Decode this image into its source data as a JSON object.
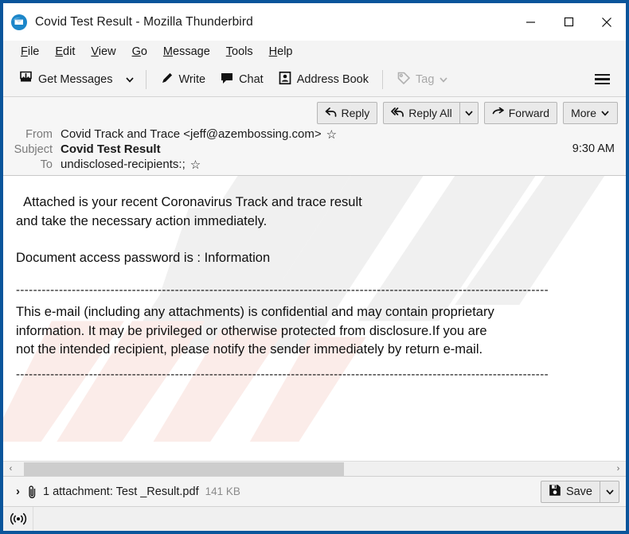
{
  "window": {
    "title": "Covid Test Result - Mozilla Thunderbird",
    "app_icon": "thunderbird-icon",
    "minimize_label": "–",
    "maximize_label": "□",
    "close_label": "✕",
    "frame_color": "#0a559b"
  },
  "menubar": {
    "items": [
      {
        "access": "F",
        "rest": "ile"
      },
      {
        "access": "E",
        "rest": "dit"
      },
      {
        "access": "V",
        "rest": "iew"
      },
      {
        "access": "G",
        "rest": "o"
      },
      {
        "access": "M",
        "rest": "essage"
      },
      {
        "access": "T",
        "rest": "ools"
      },
      {
        "access": "H",
        "rest": "elp"
      }
    ]
  },
  "toolbar": {
    "get_messages_label": "Get Messages",
    "get_messages_icon": "inbox-download-icon",
    "get_messages_caret": "⌄",
    "write_label": "Write",
    "write_icon": "pencil-icon",
    "chat_label": "Chat",
    "chat_icon": "speech-bubble-icon",
    "address_book_label": "Address Book",
    "address_book_icon": "address-book-icon",
    "tag_label": "Tag",
    "tag_icon": "tag-icon",
    "tag_caret": "⌄",
    "tag_disabled": true,
    "app_menu_icon": "hamburger-menu-icon"
  },
  "message_actions": {
    "reply_label": "Reply",
    "reply_icon": "reply-arrow-icon",
    "reply_all_label": "Reply All",
    "reply_all_icon": "reply-all-arrow-icon",
    "reply_all_caret": "⌄",
    "forward_label": "Forward",
    "forward_icon": "forward-arrow-icon",
    "more_label": "More",
    "more_caret": "⌄"
  },
  "message_header": {
    "from_label": "From",
    "from_value": "Covid Track and Trace <jeff@azembossing.com>",
    "from_star_icon": "star-outline-icon",
    "subject_label": "Subject",
    "subject_value": "Covid Test Result",
    "to_label": "To",
    "to_value": "undisclosed-recipients:;",
    "to_star_icon": "star-outline-icon",
    "time": "9:30 AM"
  },
  "message_body": {
    "line1": "  Attached is your recent Coronavirus Track and trace result",
    "line2": "and take the necessary action immediately.",
    "line3": "Document access password is : Information",
    "divider_top": "----------------------------------------------------------------------------------------------------------------------------",
    "disclaimer_line1": "This e-mail (including any attachments) is confidential and may contain proprietary",
    "disclaimer_line2": "information. It may be privileged or otherwise protected from disclosure.If you are",
    "disclaimer_line3": "not the intended recipient, please notify the sender immediately by return e-mail.",
    "divider_bottom": "----------------------------------------------------------------------------------------------------------------------------"
  },
  "scrollbar": {
    "left_arrow": "‹",
    "right_arrow": "›"
  },
  "attachment": {
    "expand_icon": "›",
    "paperclip_icon": "paperclip-icon",
    "text": "1 attachment: Test _Result.pdf",
    "size": "141 KB",
    "save_label": "Save",
    "save_icon": "floppy-disk-icon",
    "save_caret": "⌄"
  },
  "statusbar": {
    "icon": "broadcast-signal-icon"
  }
}
